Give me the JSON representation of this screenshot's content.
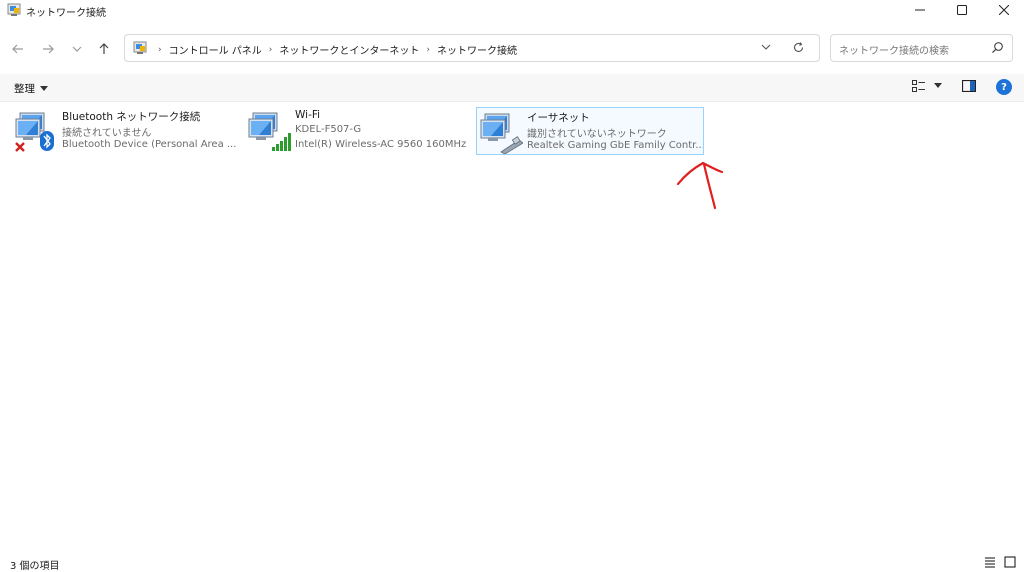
{
  "window": {
    "title": "ネットワーク接続",
    "controls": {
      "minimize": "—",
      "maximize": "☐",
      "close": "✕"
    }
  },
  "nav": {
    "back_icon": "arrow-left",
    "forward_icon": "arrow-right",
    "recent_icon": "chevron-down",
    "up_icon": "arrow-up"
  },
  "address": {
    "breadcrumbs": [
      "コントロール パネル",
      "ネットワークとインターネット",
      "ネットワーク接続"
    ],
    "separator": "›"
  },
  "search": {
    "placeholder": "ネットワーク接続の検索"
  },
  "toolbar": {
    "organize_label": "整理"
  },
  "connections": [
    {
      "name": "Bluetooth ネットワーク接続",
      "status": "接続されていません",
      "device": "Bluetooth Device (Personal Area ...",
      "overlay": "bluetooth-disconnected"
    },
    {
      "name": "Wi-Fi",
      "status": "KDEL-F507-G",
      "device": "Intel(R) Wireless-AC 9560 160MHz",
      "overlay": "wifi-signal"
    },
    {
      "name": "イーサネット",
      "status": "識別されていないネットワーク",
      "device": "Realtek Gaming GbE Family Contr...",
      "overlay": "ethernet-cable",
      "selected": true
    }
  ],
  "statusbar": {
    "item_count": "3 個の項目"
  },
  "colors": {
    "accent": "#1e73d8",
    "selection_border": "#99d1ff",
    "selection_fill": "#f4faff",
    "annotation": "#e02020",
    "disconnected": "#d32020",
    "signal": "#2e9b2e"
  }
}
